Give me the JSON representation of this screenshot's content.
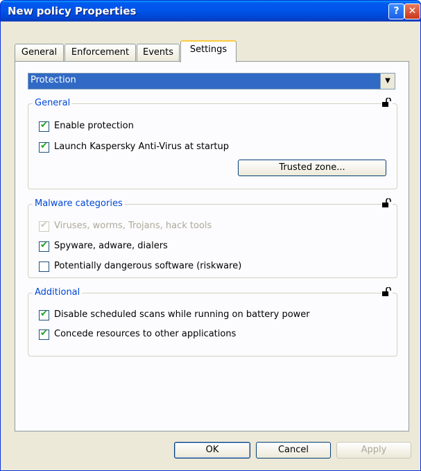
{
  "window": {
    "title": "New policy Properties"
  },
  "titlebar": {
    "help_glyph": "?",
    "close_glyph": "✕"
  },
  "tabs": [
    {
      "label": "General"
    },
    {
      "label": "Enforcement"
    },
    {
      "label": "Events"
    },
    {
      "label": "Settings",
      "active": true
    }
  ],
  "component_select": {
    "value": "Protection",
    "arrow_glyph": "▼"
  },
  "groups": {
    "general": {
      "title": "General",
      "items": [
        {
          "label": "Enable protection",
          "checked": true,
          "disabled": false
        },
        {
          "label": "Launch Kaspersky Anti-Virus at startup",
          "checked": true,
          "disabled": false
        }
      ],
      "trusted_zone_label": "Trusted zone..."
    },
    "malware": {
      "title": "Malware categories",
      "items": [
        {
          "label": "Viruses, worms, Trojans, hack tools",
          "checked": true,
          "disabled": true
        },
        {
          "label": "Spyware, adware, dialers",
          "checked": true,
          "disabled": false
        },
        {
          "label": "Potentially dangerous software (riskware)",
          "checked": false,
          "disabled": false
        }
      ]
    },
    "additional": {
      "title": "Additional",
      "items": [
        {
          "label": "Disable scheduled scans while running on battery power",
          "checked": true,
          "disabled": false
        },
        {
          "label": "Concede resources to other applications",
          "checked": true,
          "disabled": false
        }
      ]
    }
  },
  "footer": {
    "ok_label": "OK",
    "cancel_label": "Cancel",
    "apply_label": "Apply"
  },
  "check_glyph": "✔",
  "colors": {
    "titlebar": "#0054e3",
    "selection": "#316ac5",
    "group_title": "#0046d5",
    "check": "#21a121"
  },
  "icons": {
    "lock": "padlock-open-icon"
  }
}
